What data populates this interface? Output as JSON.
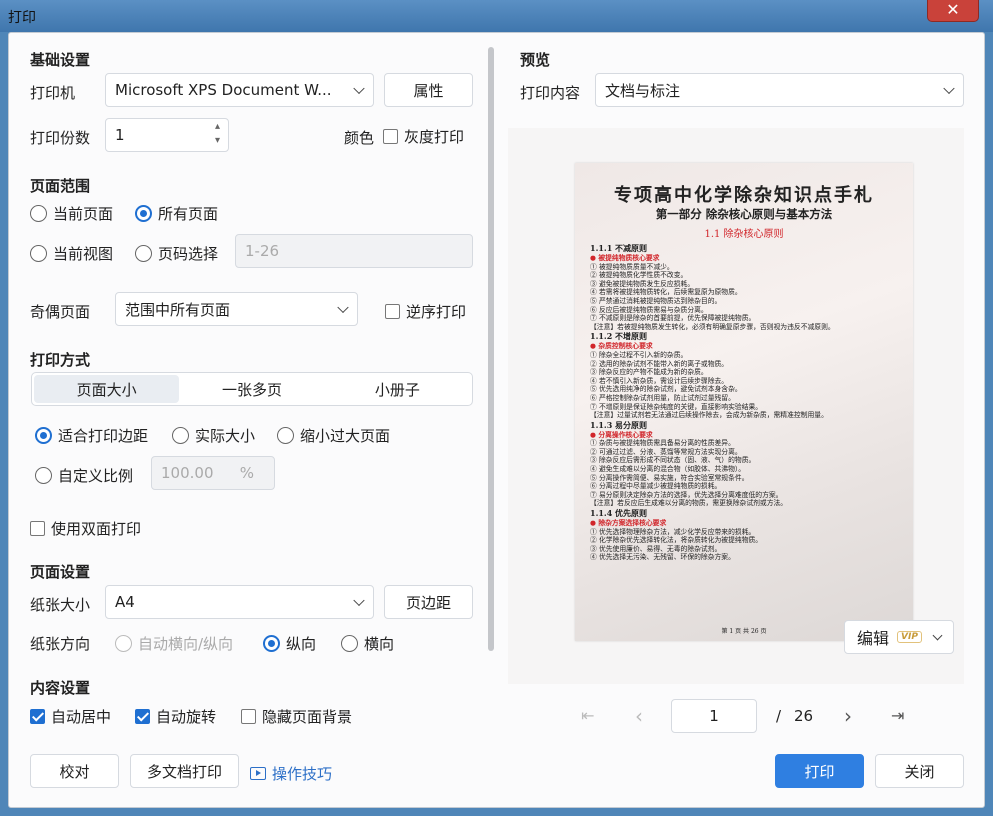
{
  "window": {
    "title": "打印",
    "close_glyph": "✕"
  },
  "basic": {
    "heading": "基础设置",
    "printer_label": "打印机",
    "printer_value": "Microsoft XPS Document W...",
    "properties_button": "属性",
    "copies_label": "打印份数",
    "copies_value": "1",
    "color_label": "颜色",
    "grayscale_label": "灰度打印",
    "grayscale_checked": false
  },
  "range": {
    "heading": "页面范围",
    "options": [
      {
        "label": "当前页面",
        "selected": false
      },
      {
        "label": "所有页面",
        "selected": true
      },
      {
        "label": "当前视图",
        "selected": false
      },
      {
        "label": "页码选择",
        "selected": false
      }
    ],
    "page_select_placeholder": "1-26",
    "odd_even_label": "奇偶页面",
    "odd_even_value": "范围中所有页面",
    "reverse_label": "逆序打印",
    "reverse_checked": false
  },
  "mode": {
    "heading": "打印方式",
    "tabs": [
      {
        "label": "页面大小",
        "active": true
      },
      {
        "label": "一张多页",
        "active": false
      },
      {
        "label": "小册子",
        "active": false
      }
    ],
    "scale_options": [
      {
        "label": "适合打印边距",
        "selected": true
      },
      {
        "label": "实际大小",
        "selected": false
      },
      {
        "label": "缩小过大页面",
        "selected": false
      },
      {
        "label": "自定义比例",
        "selected": false
      }
    ],
    "custom_scale_value": "100.00",
    "custom_scale_unit": "%",
    "duplex_label": "使用双面打印",
    "duplex_checked": false
  },
  "page_setup": {
    "heading": "页面设置",
    "paper_size_label": "纸张大小",
    "paper_size_value": "A4",
    "margins_button": "页边距",
    "orientation_label": "纸张方向",
    "orientation_options": [
      {
        "label": "自动横向/纵向",
        "selected": false,
        "disabled": true
      },
      {
        "label": "纵向",
        "selected": true,
        "disabled": false
      },
      {
        "label": "横向",
        "selected": false,
        "disabled": false
      }
    ]
  },
  "content": {
    "heading": "内容设置",
    "options": [
      {
        "label": "自动居中",
        "checked": true
      },
      {
        "label": "自动旋转",
        "checked": true
      },
      {
        "label": "隐藏页面背景",
        "checked": false
      }
    ]
  },
  "footer_left": {
    "proof_button": "校对",
    "multi_doc_button": "多文档打印",
    "tips_link": "操作技巧"
  },
  "preview": {
    "heading": "预览",
    "content_label": "打印内容",
    "content_value": "文档与标注",
    "edit_button": "编辑",
    "vip_badge": "VIP",
    "current_page": "1",
    "page_separator": "/",
    "total_pages": "26",
    "doc": {
      "title": "专项高中化学除杂知识点手札",
      "subtitle": "第一部分 除杂核心原则与基本方法",
      "section": "1.1 除杂核心原则",
      "lines": [
        {
          "t": "1.1.1 不减原则",
          "k": "hd"
        },
        {
          "t": "被提纯物质核心要求",
          "k": "red"
        },
        {
          "t": "① 被提纯物质质量不减少。",
          "k": ""
        },
        {
          "t": "② 被提纯物质化学性质不改变。",
          "k": ""
        },
        {
          "t": "③ 避免被提纯物质发生反应损耗。",
          "k": ""
        },
        {
          "t": "④ 若需将被提纯物质转化，后续需复原为原物质。",
          "k": ""
        },
        {
          "t": "⑤ 严禁通过消耗被提纯物质达到除杂目的。",
          "k": ""
        },
        {
          "t": "⑥ 反应后被提纯物质需易与杂质分离。",
          "k": ""
        },
        {
          "t": "⑦ 不减原则是除杂的首要前提，优先保障被提纯物质。",
          "k": ""
        },
        {
          "t": "【注意】若被提纯物质发生转化，必须有明确复原步骤，否则视为违反不减原则。",
          "k": ""
        },
        {
          "t": "1.1.2 不增原则",
          "k": "hd"
        },
        {
          "t": "杂质控制核心要求",
          "k": "red"
        },
        {
          "t": "① 除杂全过程不引入新的杂质。",
          "k": ""
        },
        {
          "t": "② 选用的除杂试剂不能带入新的离子或物质。",
          "k": ""
        },
        {
          "t": "③ 除杂反应的产物不能成为新的杂质。",
          "k": ""
        },
        {
          "t": "④ 若不慎引入新杂质，需设计后续步骤除去。",
          "k": ""
        },
        {
          "t": "⑤ 优先选用纯净的除杂试剂，避免试剂本身含杂。",
          "k": ""
        },
        {
          "t": "⑥ 严格控制除杂试剂用量，防止试剂过量残留。",
          "k": ""
        },
        {
          "t": "⑦ 不增原则是保证除杂纯度的关键，直接影响实验结果。",
          "k": ""
        },
        {
          "t": "【注意】过量试剂若无法通过后续操作除去，会成为新杂质，需精准控制用量。",
          "k": ""
        },
        {
          "t": "1.1.3 易分原则",
          "k": "hd"
        },
        {
          "t": "分离操作核心要求",
          "k": "red"
        },
        {
          "t": "① 杂质与被提纯物质需具备易分离的性质差异。",
          "k": ""
        },
        {
          "t": "② 可通过过滤、分液、蒸馏等常规方法实现分离。",
          "k": ""
        },
        {
          "t": "③ 除杂反应后需形成不同状态（固、液、气）的物质。",
          "k": ""
        },
        {
          "t": "④ 避免生成难以分离的混合物（如胶体、共沸物）。",
          "k": ""
        },
        {
          "t": "⑤ 分离操作需简便、易实施，符合实验室常规条件。",
          "k": ""
        },
        {
          "t": "⑥ 分离过程中尽量减少被提纯物质的损耗。",
          "k": ""
        },
        {
          "t": "⑦ 易分原则决定除杂方法的选择，优先选择分离难度低的方案。",
          "k": ""
        },
        {
          "t": "【注意】若反应后生成难以分离的物质，需更换除杂试剂或方法。",
          "k": ""
        },
        {
          "t": "1.1.4 优先原则",
          "k": "hd"
        },
        {
          "t": "除杂方案选择核心要求",
          "k": "red"
        },
        {
          "t": "① 优先选择物理除杂方法，减少化学反应带来的损耗。",
          "k": ""
        },
        {
          "t": "② 化学除杂优先选择转化法，将杂质转化为被提纯物质。",
          "k": ""
        },
        {
          "t": "③ 优先使用廉价、易得、无毒的除杂试剂。",
          "k": ""
        },
        {
          "t": "④ 优先选择无污染、无残留、环保的除杂方案。",
          "k": ""
        }
      ],
      "footer": "第 1 页 共 26 页"
    }
  },
  "actions": {
    "print_button": "打印",
    "close_button": "关闭"
  },
  "icons": {
    "chevron": "chevron-down-icon",
    "first": "⇤",
    "prev": "‹",
    "next": "›",
    "last": "⇥",
    "spin_up": "▴",
    "spin_down": "▾"
  },
  "colors": {
    "accent": "#2f7fe1",
    "link": "#2c6fc7",
    "titlebar": "#4a82ba",
    "close": "#c9423a"
  }
}
